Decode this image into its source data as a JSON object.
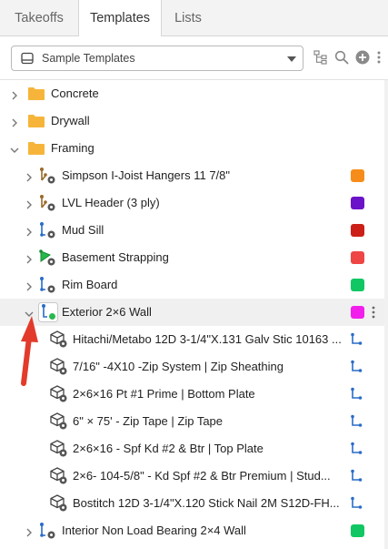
{
  "tabs": [
    "Takeoffs",
    "Templates",
    "Lists"
  ],
  "active_tab": "Templates",
  "template_selector": {
    "value": "Sample Templates"
  },
  "colors": {
    "folder": "#f6b53a",
    "takeoff_icon": "#2a6cc8",
    "arrow": "#e23b2c"
  },
  "tree": [
    {
      "label": "Concrete",
      "kind": "folder",
      "level": 0,
      "expanded": false
    },
    {
      "label": "Drywall",
      "kind": "folder",
      "level": 0,
      "expanded": false
    },
    {
      "label": "Framing",
      "kind": "folder",
      "level": 0,
      "expanded": true
    },
    {
      "label": "Simpson I-Joist Hangers 11 7/8\"",
      "kind": "count-item",
      "level": 1,
      "expanded": false,
      "color": "#f68d1a"
    },
    {
      "label": "LVL Header (3 ply)",
      "kind": "count-item",
      "level": 1,
      "expanded": false,
      "color": "#6b13c8"
    },
    {
      "label": "Mud Sill",
      "kind": "linear-item",
      "level": 1,
      "expanded": false,
      "color": "#cc1f17"
    },
    {
      "label": "Basement Strapping",
      "kind": "area-item",
      "level": 1,
      "expanded": false,
      "color": "#ee4545"
    },
    {
      "label": "Rim Board",
      "kind": "linear-item",
      "level": 1,
      "expanded": false,
      "color": "#11c763"
    },
    {
      "label": "Exterior 2×6 Wall",
      "kind": "linear-item-active",
      "level": 1,
      "expanded": true,
      "color": "#f21fec",
      "selected": true
    },
    {
      "label": "Hitachi/Metabo 12D 3-1/4\"X.131 Galv Stic 10163 ...",
      "kind": "assembly-part",
      "level": 2
    },
    {
      "label": "7/16\" -4X10 -Zip System | Zip Sheathing",
      "kind": "assembly-part",
      "level": 2
    },
    {
      "label": "2×6×16 Pt #1 Prime | Bottom Plate",
      "kind": "assembly-part",
      "level": 2
    },
    {
      "label": "6\" × 75' - Zip Tape | Zip Tape",
      "kind": "assembly-part",
      "level": 2
    },
    {
      "label": "2×6×16 - Spf Kd #2 & Btr | Top Plate",
      "kind": "assembly-part",
      "level": 2
    },
    {
      "label": "2×6- 104-5/8\" - Kd Spf #2 & Btr Premium | Stud...",
      "kind": "assembly-part",
      "level": 2
    },
    {
      "label": "Bostitch 12D 3-1/4\"X.120 Stick Nail 2M S12D-FH...",
      "kind": "assembly-part",
      "level": 2
    },
    {
      "label": "Interior Non Load Bearing 2×4 Wall",
      "kind": "linear-item",
      "level": 1,
      "expanded": false,
      "color": "#11c763"
    }
  ]
}
